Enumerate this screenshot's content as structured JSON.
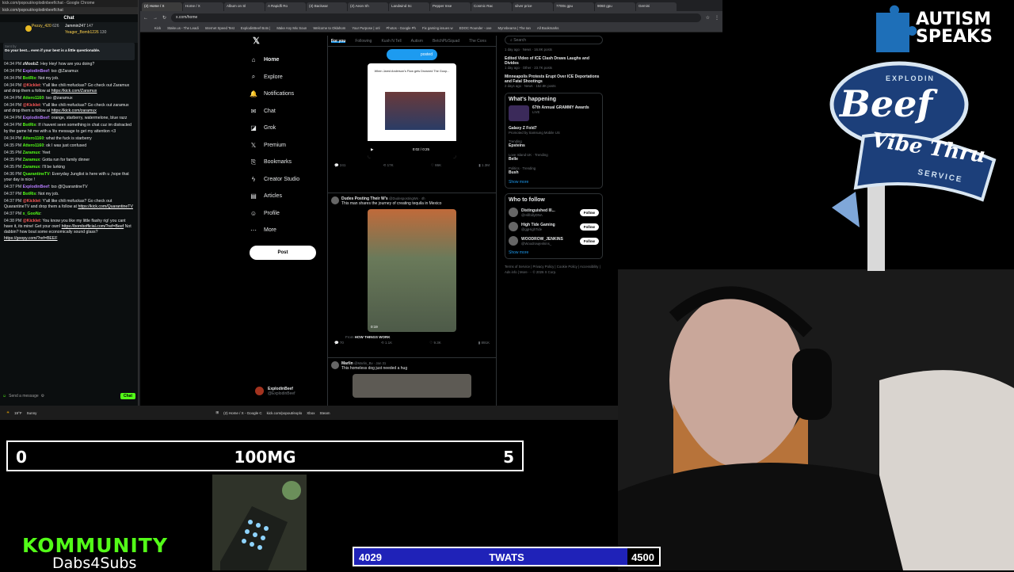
{
  "chat": {
    "window_title": "kick.com/popout/explodinbeef/chat - Google Chrome",
    "url": "kick.com/popout/explodinbeef/chat",
    "header": "Chat",
    "top_users": [
      {
        "name": "Pezzy_420",
        "count": "626"
      },
      {
        "name": "Jammin247",
        "count": "147"
      },
      {
        "name": "Yeager_Bomb1226",
        "count": "130"
      }
    ],
    "pinned_by": "Sent by",
    "pinned_text": "Do your best... even if your best is a little questionable.",
    "messages": [
      {
        "time": "04:34 PM",
        "user": "zMoobZ",
        "color": "#e3e3e3",
        "text": "Hey Hey! how are you doing?"
      },
      {
        "time": "04:34 PM",
        "user": "ExplodinBeef",
        "color": "#b77cff",
        "text": "tso @Zaramux"
      },
      {
        "time": "04:34 PM",
        "user": "BotRix",
        "color": "#53fc18",
        "text": "Not my job."
      },
      {
        "time": "04:34 PM",
        "user": "@Kicklet",
        "color": "#ff5a5a",
        "text": "Y'all like chili mofuckas? Go check out Zaramux and drop them a follow at",
        "link": "https://kick.com/Zaramux"
      },
      {
        "time": "04:34 PM",
        "user": "Attero1160",
        "color": "#53fc18",
        "text": "tso @zaramux"
      },
      {
        "time": "04:34 PM",
        "user": "@Kicklet",
        "color": "#ff5a5a",
        "text": "Y'all like chili mofuckas? Go check out zaramux and drop them a follow at",
        "link": "https://kick.com/zaramux"
      },
      {
        "time": "04:34 PM",
        "user": "ExplodinBeef",
        "color": "#b77cff",
        "text": "orange, starberry, watermelone, blue razz"
      },
      {
        "time": "04:34 PM",
        "user": "BotRix",
        "color": "#53fc18",
        "text": "If i havent seen something in chat cuz im distracted by the game hit me with a !its message to get my attention <3"
      },
      {
        "time": "04:34 PM",
        "user": "Attero1160",
        "color": "#53fc18",
        "text": "what the fuck is starberry"
      },
      {
        "time": "04:35 PM",
        "user": "Attero1160",
        "color": "#53fc18",
        "text": "ok I was just confused"
      },
      {
        "time": "04:35 PM",
        "user": "Zaramux",
        "color": "#53fc18",
        "text": "Yeet"
      },
      {
        "time": "04:35 PM",
        "user": "Zaramux",
        "color": "#53fc18",
        "text": "Gotta run for family dinner"
      },
      {
        "time": "04:35 PM",
        "user": "Zaramux",
        "color": "#53fc18",
        "text": "I'll be lurking"
      },
      {
        "time": "04:36 PM",
        "user": "QuarantineTV",
        "color": "#53fc18",
        "text": "Everyday Junglist is here with u ,hope that your day is nice !"
      },
      {
        "time": "04:37 PM",
        "user": "ExplodinBeef",
        "color": "#b77cff",
        "text": "tso @QuarantineTV"
      },
      {
        "time": "04:37 PM",
        "user": "BotRix",
        "color": "#53fc18",
        "text": "Not my job."
      },
      {
        "time": "04:37 PM",
        "user": "@Kicklet",
        "color": "#ff5a5a",
        "text": "Y'all like chili mofuckas? Go check out QuarantineTV and drop them a follow at",
        "link": "https://kick.com/QuarantineTV"
      },
      {
        "time": "04:37 PM",
        "user": "x_GooNz",
        "color": "#53fc18",
        "text": ""
      },
      {
        "time": "04:38 PM",
        "user": "@Kicklet",
        "color": "#ff5a5a",
        "text": "You know you like my little flashy rig! you cant have it, its mine! Get your own!",
        "link": "https://bombofficial.com/?ref=Beef",
        "text2": "Not dabbin? how bout some economically sound glass?",
        "link2": "https://goopy.com/?ref=BEEF"
      }
    ],
    "input_placeholder": "Send a message",
    "send_label": "Chat"
  },
  "browser": {
    "tabs": [
      "(2) Home / X",
      "Home / X",
      "Album on Sl",
      "A Rapidfi Ro",
      "(3) Backwar",
      "(2) Aeon Sh",
      "Landwind Sc",
      "Pepper Inse",
      "Cosmic Rac",
      "silver price",
      "7700s gpu",
      "9060 gpu",
      "Gemini"
    ],
    "url": "x.com/home",
    "bookmarks": [
      "Kick",
      "Stake.us - The Leadi",
      "Internet Speed Test",
      "ExplodinBeef Bots |",
      "Make Any Mix Soun",
      "Welcome to Oklahom",
      "Your Purpose | onl",
      "Photos - Google Ph",
      "Fix gaming issues w",
      "EDOC Rounder - ove",
      "Mynnbearss | The Ian",
      "All Bookmarks"
    ]
  },
  "x": {
    "nav": [
      {
        "icon": "home-icon",
        "glyph": "⌂",
        "label": "Home"
      },
      {
        "icon": "search-icon",
        "glyph": "⌕",
        "label": "Explore"
      },
      {
        "icon": "bell-icon",
        "glyph": "🔔",
        "label": "Notifications"
      },
      {
        "icon": "mail-icon",
        "glyph": "✉",
        "label": "Chat"
      },
      {
        "icon": "grok-icon",
        "glyph": "◪",
        "label": "Grok"
      },
      {
        "icon": "x-premium-icon",
        "glyph": "𝕏",
        "label": "Premium"
      },
      {
        "icon": "bookmark-icon",
        "glyph": "⎘",
        "label": "Bookmarks"
      },
      {
        "icon": "lightning-icon",
        "glyph": "ϟ",
        "label": "Creator Studio"
      },
      {
        "icon": "article-icon",
        "glyph": "▤",
        "label": "Articles"
      },
      {
        "icon": "profile-icon",
        "glyph": "☺",
        "label": "Profile"
      },
      {
        "icon": "more-icon",
        "glyph": "⋯",
        "label": "More"
      }
    ],
    "post_label": "Post",
    "profile_name": "ExplodinBeef",
    "profile_handle": "@ExplodinBeef",
    "feed_tabs": [
      "For you",
      "Following",
      "Kush N Tell",
      "Autism",
      "BetchPlzSquad",
      "The Cons"
    ],
    "posted_pill": "posted",
    "post1": {
      "media_caption": "When Jared Anderson's Flow gets Drowned The Goop...",
      "time": "0:02 / 0:25",
      "stats": [
        "241",
        "17K",
        "86K",
        "1.3M"
      ]
    },
    "post2": {
      "name": "Dudes Posting Their W's",
      "handle": "@DudespostingWs · 4h",
      "text": "This man shares the journey of creating tequila in Mexico",
      "duration": "0:19",
      "from_label": "From",
      "from": "HOW THINGS WORK",
      "stats": [
        "70",
        "1.1K",
        "9.3K",
        "891K"
      ]
    },
    "post3": {
      "name": "Marlin",
      "handle": "@Marlin_Bv · Jan 31",
      "text": "This homeless dog just needed a hug"
    }
  },
  "right": {
    "search_placeholder": "Search",
    "top_news": [
      {
        "meta": "1 day ago · News · 16.8K posts",
        "title": ""
      },
      {
        "meta": "1 day ago · Other · 23.7K posts",
        "title": "Edited Video of ICE Clash Draws Laughs and Divides"
      },
      {
        "meta": "2 days ago · News · 152.8K posts",
        "title": "Minneapolis Protests Erupt Over ICE Deportations and Fatal Shootings"
      }
    ],
    "happening_title": "What's happening",
    "event": {
      "title": "67th Annual GRAMMY Awards",
      "status": "LIVE"
    },
    "trends": [
      {
        "meta": "",
        "name": "Galaxy Z Fold7",
        "desc": "Promoted by Samsung Mobile US"
      },
      {
        "meta": "Trending",
        "name": "Epsteins",
        "desc": ""
      },
      {
        "meta": "Love Island UK · Trending",
        "name": "Belle",
        "desc": ""
      },
      {
        "meta": "Politics · Trending",
        "name": "Bush",
        "desc": ""
      }
    ],
    "show_more": "Show more",
    "wtf_title": "Who to follow",
    "follow": [
      {
        "name": "Distinguished Ill...",
        "handle": "@HillbillyDNA"
      },
      {
        "name": "High Tide Gaming",
        "handle": "@ggHighTide"
      },
      {
        "name": "WOODROW_JENKINS",
        "handle": "@Woodrowjenkins_"
      }
    ],
    "follow_label": "Follow",
    "footer": "Terms of Service  |  Privacy Policy  |  Cookie Policy  |  Accessibility  |  Ads info  |  More ···  © 2026 X Corp."
  },
  "taskbar": {
    "weather": "19°F",
    "weather_desc": "Sunny",
    "apps": [
      "(2) Home / X - Google C",
      "kick.com/popout/explo",
      "Xbox",
      "Steam"
    ]
  },
  "overlay": {
    "score_left": "0",
    "score_center": "100MG",
    "score_right": "5",
    "goal_current": "4029",
    "goal_label": "TWATS",
    "goal_target": "4500",
    "goal_fraction": 0.895,
    "kommunity_title": "KOMMUNITY",
    "kommunity_sub": "Dabs4Subs",
    "autism_line1": "AUTISM",
    "autism_line2": "SPEAKS",
    "sign_top": "EXPLODIN",
    "sign_beef": "Beef",
    "sign_vibe": "Vibe Thru",
    "sign_service": "SERVICE"
  },
  "colors": {
    "kick_green": "#53fc18",
    "x_blue": "#1d9bf0",
    "goal_blue": "#1f22b8",
    "autism_blue": "#1e6fb8"
  }
}
